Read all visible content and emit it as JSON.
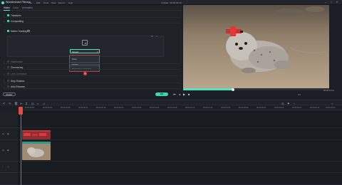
{
  "titlebar": {
    "app_title": "Wondershare Filmora",
    "menus": [
      "File",
      "Edit",
      "Tools",
      "View",
      "Export",
      "Help"
    ],
    "document_title": "Untitled : 00:00:03:18"
  },
  "tabs": [
    {
      "label": "Video",
      "active": true
    },
    {
      "label": "Color",
      "active": false
    },
    {
      "label": "Animation",
      "active": false
    }
  ],
  "sections": [
    {
      "label": "Transform",
      "enabled": true
    },
    {
      "label": "Compositing",
      "enabled": true
    },
    {
      "label": "Motion Tracking",
      "enabled": true
    },
    {
      "label": "Stabilization",
      "enabled": false
    },
    {
      "label": "Chroma key",
      "enabled": false
    },
    {
      "label": "Lens Correction",
      "enabled": false
    },
    {
      "label": "Drop Shadow",
      "enabled": false
    },
    {
      "label": "Auto Enhance",
      "enabled": false
    }
  ],
  "motion_tracking": {
    "dropdown_value": "Mosaic",
    "options": [
      "None",
      "Mosaic",
      "Import from computer"
    ],
    "selected_option": "Mosaic",
    "step_marker": "1"
  },
  "buttons": {
    "reset": "RESET",
    "ok": "OK"
  },
  "player": {
    "time": "00:00:01:04",
    "ratio": "1/2",
    "progress": 0.34
  },
  "ruler_ticks": [
    "00:00:00:00",
    "00:00:00:04",
    "00:00:00:08",
    "00:00:00:12",
    "00:00:00:16",
    "00:00:00:20",
    "00:00:01:00",
    "00:00:01:04",
    "00:00:01:08",
    "00:00:01:12",
    "00:00:01:16",
    "00:00:01:20",
    "00:00:02:00",
    "00:00:02:04",
    "00:00:02:08",
    "00:00:02:12",
    "00:00:02:16",
    "00:00:02:20"
  ],
  "colors": {
    "accent": "#4fe3c1",
    "playhead": "#e04b4b",
    "fx_clip": "#8c2f34"
  },
  "icons": {
    "window": [
      "minimize-icon",
      "maximize-icon",
      "close-icon"
    ],
    "toolbar": [
      "undo-icon",
      "redo-icon",
      "delete-icon",
      "cut-icon",
      "crop-icon",
      "speed-icon",
      "color-icon",
      "audio-icon",
      "render-icon",
      "marker-icon",
      "zoom-out-icon",
      "zoom-in-icon"
    ]
  }
}
